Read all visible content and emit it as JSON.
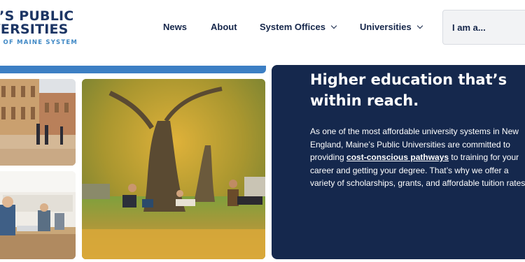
{
  "header": {
    "logo": {
      "line1": "E’S PUBLIC",
      "line2": "VERSITIES",
      "line3": "TY OF MAINE SYSTEM"
    },
    "nav": [
      {
        "label": "News",
        "has_dropdown": false
      },
      {
        "label": "About",
        "has_dropdown": false
      },
      {
        "label": "System Offices",
        "has_dropdown": true
      },
      {
        "label": "Universities",
        "has_dropdown": true
      }
    ],
    "audience_select": {
      "label": "I am a..."
    }
  },
  "colors": {
    "navy": "#15284d",
    "accent_blue": "#3c7fc4",
    "logo_blue": "#3f88c5"
  },
  "icons": {
    "dropdown": "chevron-down-icon"
  },
  "hero": {
    "heading": "Higher education that’s within reach.",
    "body_before": "As one of the most affordable university systems in New England, Maine’s Public Universities are committed to providing ",
    "link_text": "cost-conscious pathways",
    "body_after": " to training for your career and getting your degree. That’s why we offer a variety of scholarships, grants, and affordable tuition rates."
  }
}
